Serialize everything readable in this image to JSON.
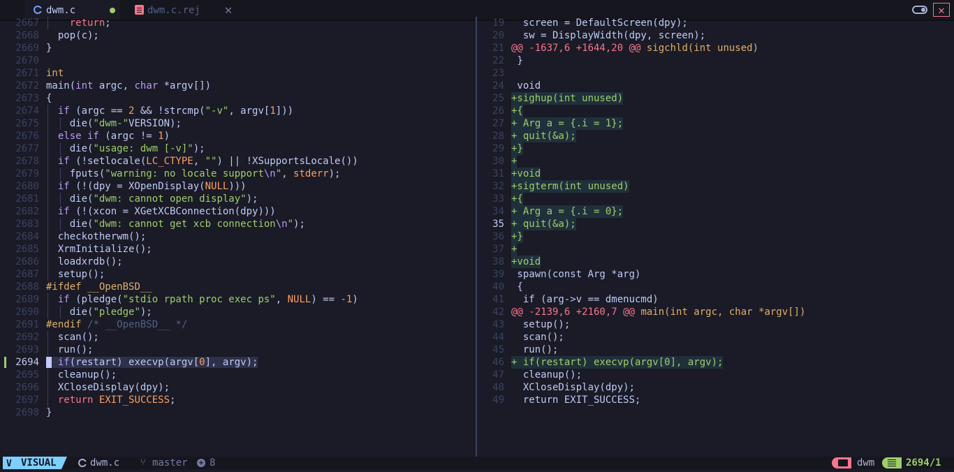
{
  "tabs": [
    {
      "label": "dwm.c",
      "icon": "c-file-icon",
      "active": true,
      "modified": true
    },
    {
      "label": "dwm.c.rej",
      "icon": "document-icon",
      "active": false,
      "close": "✕"
    }
  ],
  "window": {
    "toggle_icon": "toggle-icon",
    "close": "✕"
  },
  "left_pane": {
    "file": "dwm.c",
    "current_line": "2694",
    "lines": [
      {
        "n": "2667"
      },
      {
        "n": "2668"
      },
      {
        "n": "2669"
      },
      {
        "n": "2670"
      },
      {
        "n": "2671"
      },
      {
        "n": "2672"
      },
      {
        "n": "2673"
      },
      {
        "n": "2674"
      },
      {
        "n": "2675"
      },
      {
        "n": "2676"
      },
      {
        "n": "2677"
      },
      {
        "n": "2678"
      },
      {
        "n": "2679"
      },
      {
        "n": "2680"
      },
      {
        "n": "2681"
      },
      {
        "n": "2682"
      },
      {
        "n": "2683"
      },
      {
        "n": "2684"
      },
      {
        "n": "2685"
      },
      {
        "n": "2686"
      },
      {
        "n": "2687"
      },
      {
        "n": "2688"
      },
      {
        "n": "2689"
      },
      {
        "n": "2690"
      },
      {
        "n": "2691"
      },
      {
        "n": "2692"
      },
      {
        "n": "2693"
      },
      {
        "n": "2694"
      },
      {
        "n": "2695"
      },
      {
        "n": "2696"
      },
      {
        "n": "2697"
      },
      {
        "n": "2698"
      }
    ]
  },
  "right_pane": {
    "file": "dwm.c.rej",
    "current_line": "35",
    "lines": [
      {
        "n": "19",
        "text": "  screen = DefaultScreen(dpy);"
      },
      {
        "n": "20",
        "text": "  sw = DisplayWidth(dpy, screen);"
      },
      {
        "n": "21",
        "text": "@@ -1637,6 +1644,20 @@ sigchld(int unused)"
      },
      {
        "n": "22",
        "text": " }"
      },
      {
        "n": "23",
        "text": ""
      },
      {
        "n": "24",
        "text": " void"
      },
      {
        "n": "25",
        "text": "+sighup(int unused)"
      },
      {
        "n": "26",
        "text": "+{"
      },
      {
        "n": "27",
        "text": "+ Arg a = {.i = 1};"
      },
      {
        "n": "28",
        "text": "+ quit(&a);"
      },
      {
        "n": "29",
        "text": "+}"
      },
      {
        "n": "30",
        "text": "+"
      },
      {
        "n": "31",
        "text": "+void"
      },
      {
        "n": "32",
        "text": "+sigterm(int unused)"
      },
      {
        "n": "33",
        "text": "+{"
      },
      {
        "n": "34",
        "text": "+ Arg a = {.i = 0};"
      },
      {
        "n": "35",
        "text": "+ quit(&a);"
      },
      {
        "n": "36",
        "text": "+}"
      },
      {
        "n": "37",
        "text": "+"
      },
      {
        "n": "38",
        "text": "+void"
      },
      {
        "n": "39",
        "text": " spawn(const Arg *arg)"
      },
      {
        "n": "40",
        "text": " {"
      },
      {
        "n": "41",
        "text": "  if (arg->v == dmenucmd)"
      },
      {
        "n": "42",
        "text": "@@ -2139,6 +2160,7 @@ main(int argc, char *argv[])"
      },
      {
        "n": "43",
        "text": "  setup();"
      },
      {
        "n": "44",
        "text": "  scan();"
      },
      {
        "n": "45",
        "text": "  run();"
      },
      {
        "n": "46",
        "text": "+ if(restart) execvp(argv[0], argv);"
      },
      {
        "n": "47",
        "text": "  cleanup();"
      },
      {
        "n": "48",
        "text": "  XCloseDisplay(dpy);"
      },
      {
        "n": "49",
        "text": "  return EXIT_SUCCESS;"
      }
    ]
  },
  "statusbar": {
    "mode": "VISUAL",
    "mode_icon": "vim-icon",
    "filename": "dwm.c",
    "branch": "master",
    "added_count": "8",
    "directory": "dwm",
    "position": "2694/1"
  },
  "colors": {
    "background": "#1a1b26",
    "keyword": "#bb9af7",
    "string": "#9ece6a",
    "number": "#ff9e64",
    "preproc": "#e0af68",
    "return": "#f7768e",
    "diff_add": "#9ece6a",
    "diff_hunk": "#f7768e",
    "mode_badge": "#7dcfff"
  }
}
